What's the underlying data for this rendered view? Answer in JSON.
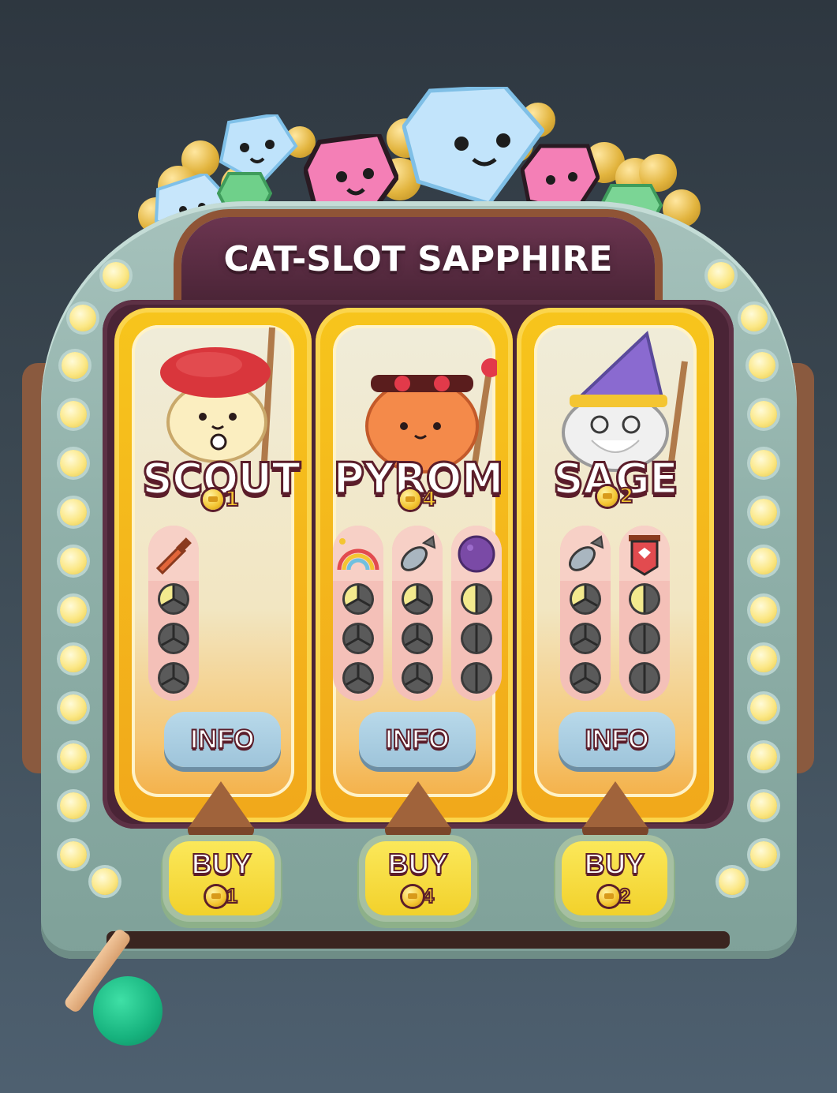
{
  "machine": {
    "title": "CAT-SLOT SAPPHIRE"
  },
  "reels": [
    {
      "name": "SCOUT",
      "cost": "1",
      "info_label": "INFO",
      "buy_label": "BUY",
      "buy_cost": "1",
      "abilities": [
        {
          "icon": "knife-icon",
          "pips_filled": 1,
          "pip_segments": 3,
          "pip_count": 3
        }
      ]
    },
    {
      "name": "PYROM",
      "cost": "4",
      "info_label": "INFO",
      "buy_label": "BUY",
      "buy_cost": "4",
      "abilities": [
        {
          "icon": "rainbow-icon",
          "pips_filled": 1,
          "pip_segments": 3,
          "pip_count": 3
        },
        {
          "icon": "bomb-icon",
          "pips_filled": 1,
          "pip_segments": 3,
          "pip_count": 3
        },
        {
          "icon": "purple-orb-icon",
          "pips_filled": 1,
          "pip_segments": 2,
          "pip_count": 3
        }
      ]
    },
    {
      "name": "SAGE",
      "cost": "2",
      "info_label": "INFO",
      "buy_label": "BUY",
      "buy_cost": "2",
      "abilities": [
        {
          "icon": "bomb-icon",
          "pips_filled": 1,
          "pip_segments": 3,
          "pip_count": 3
        },
        {
          "icon": "banner-shield-icon",
          "pips_filled": 1,
          "pip_segments": 2,
          "pip_count": 3
        }
      ]
    }
  ],
  "colors": {
    "reel_gold": "#f7c51c",
    "coin": "#f4c531",
    "text_outline": "#5b1d2a",
    "lever_knob": "#17b37e"
  }
}
